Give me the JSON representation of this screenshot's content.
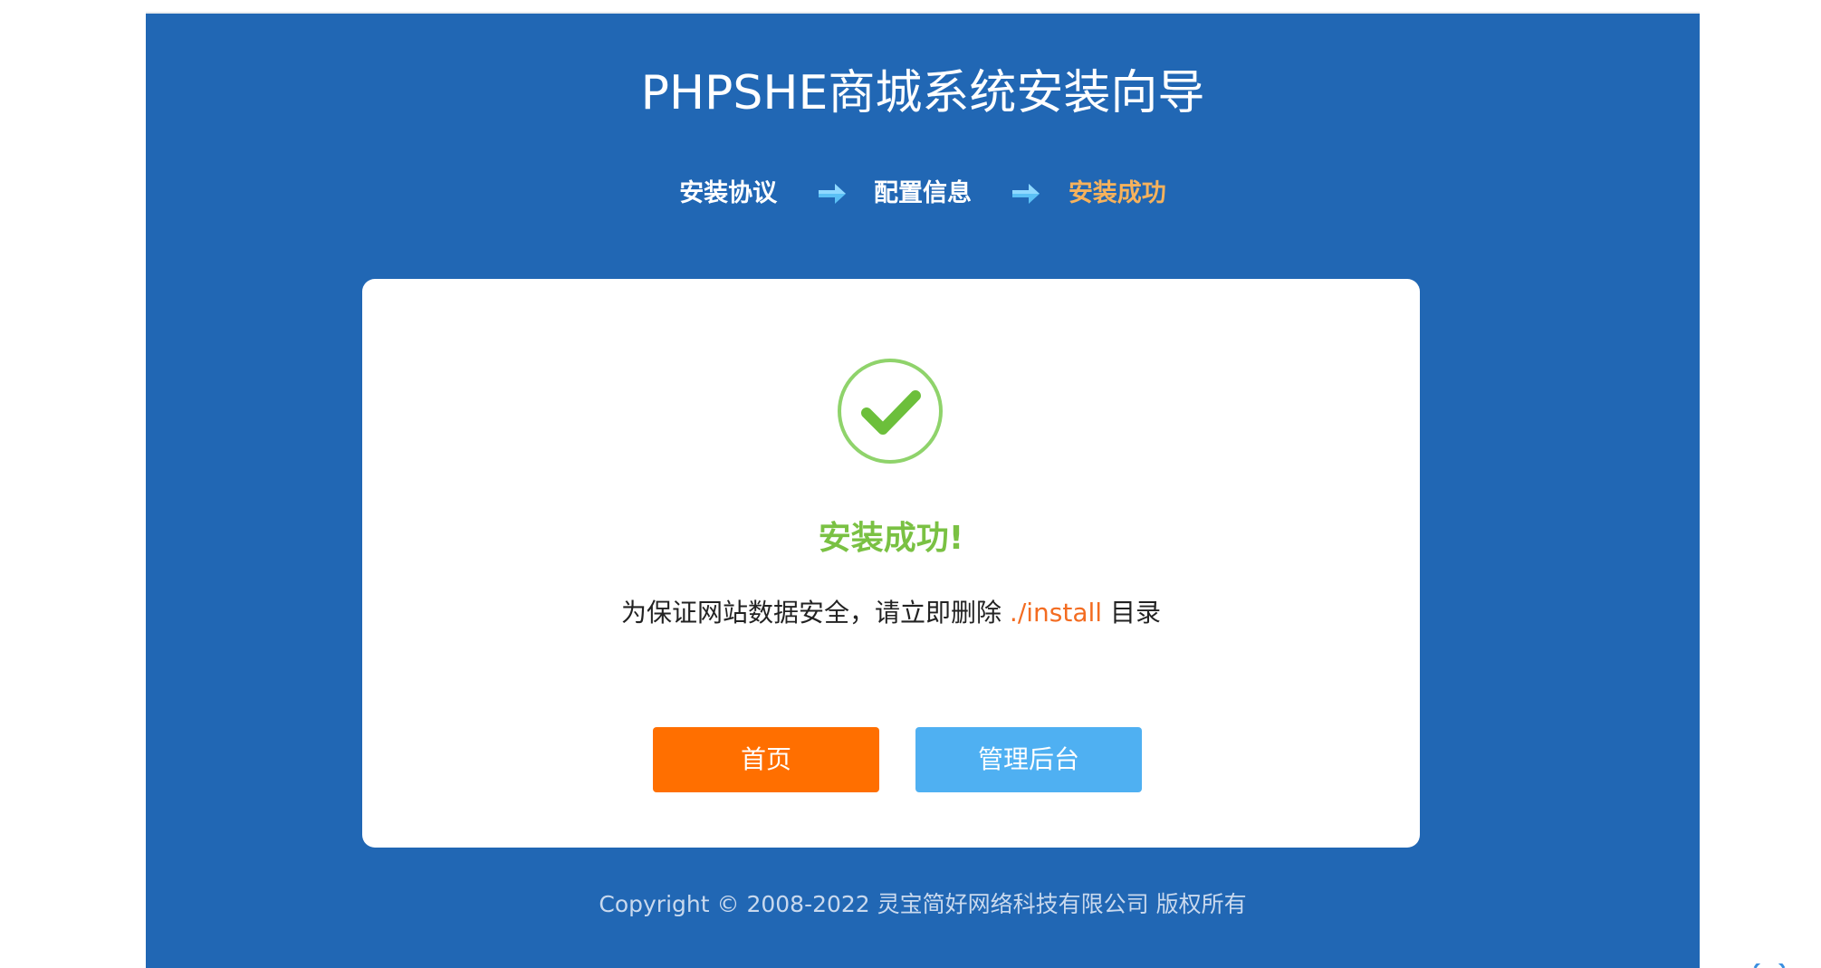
{
  "title": "PHPSHE商城系统安装向导",
  "steps": [
    {
      "label": "安装协议",
      "state": "done"
    },
    {
      "label": "配置信息",
      "state": "done"
    },
    {
      "label": "安装成功",
      "state": "current"
    }
  ],
  "step_arrow_icon": "arrow-right-icon",
  "success": {
    "icon": "check-circle-icon",
    "title": "安装成功!",
    "notice_prefix": "为保证网站数据安全，请立即删除 ",
    "notice_path": "./install",
    "notice_suffix": " 目录"
  },
  "buttons": {
    "home_label": "首页",
    "admin_label": "管理后台"
  },
  "footer": {
    "copyright": "Copyright © 2008-2022 灵宝简好网络科技有限公司 版权所有"
  },
  "colors": {
    "panel_bg": "#2167b4",
    "current_step": "#f6b25c",
    "success_green": "#7ac143",
    "path_orange": "#f36c21",
    "home_button": "#ff6f00",
    "admin_button": "#4fb0f2"
  }
}
